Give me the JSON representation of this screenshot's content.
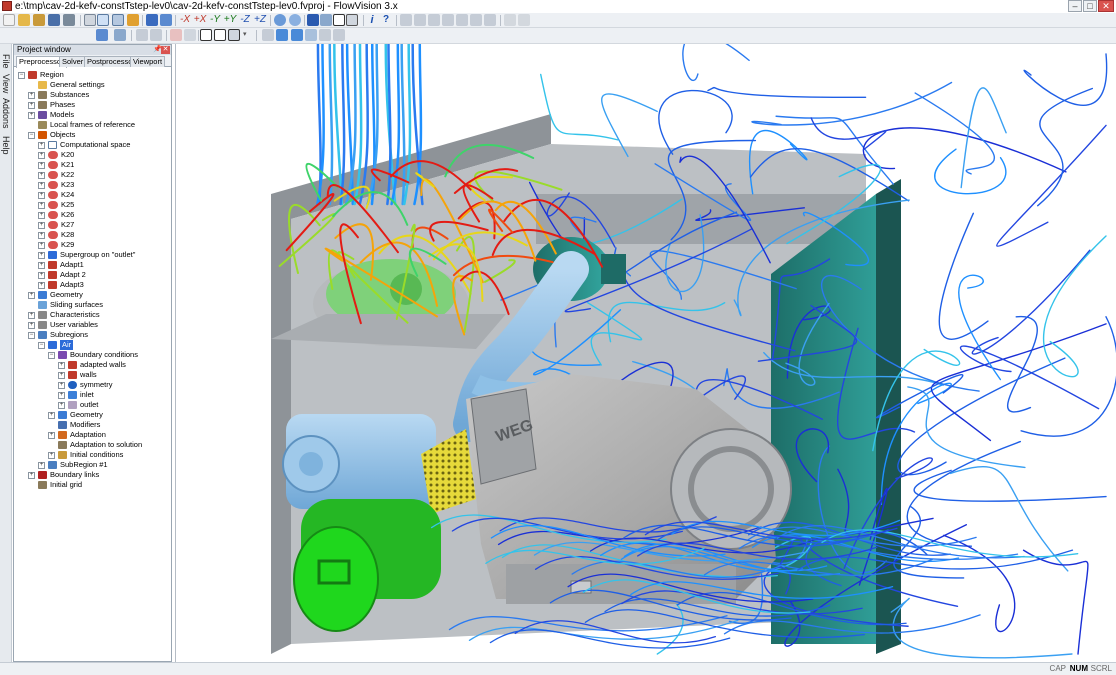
{
  "window": {
    "title": "e:\\tmp\\cav-2d-kefv-constTstep-lev0\\cav-2d-kefv-constTstep-lev0.fvproj - FlowVision 3.x",
    "minimize": "–",
    "maximize": "□",
    "close": "✕"
  },
  "toolbar": {
    "axis_buttons": [
      "-X",
      "+X",
      "-Y",
      "+Y",
      "-Z",
      "+Z"
    ]
  },
  "sidebar_tabs": [
    "File",
    "View",
    "Addons",
    "Help"
  ],
  "project_window": {
    "title": "Project window",
    "tabs": [
      "Preprocessor",
      "Solver",
      "Postprocessor",
      "Viewport"
    ],
    "active_tab": "Preprocessor",
    "tree": [
      {
        "label": "Region"
      },
      {
        "label": "General settings"
      },
      {
        "label": "Substances"
      },
      {
        "label": "Phases"
      },
      {
        "label": "Models"
      },
      {
        "label": "Local frames of reference"
      },
      {
        "label": "Objects"
      },
      {
        "label": "Computational space"
      },
      {
        "label": "K20"
      },
      {
        "label": "K21"
      },
      {
        "label": "K22"
      },
      {
        "label": "K23"
      },
      {
        "label": "K24"
      },
      {
        "label": "K25"
      },
      {
        "label": "K26"
      },
      {
        "label": "K27"
      },
      {
        "label": "K28"
      },
      {
        "label": "K29"
      },
      {
        "label": "Supergroup on \"outlet\""
      },
      {
        "label": "Adapt1"
      },
      {
        "label": "Adapt 2"
      },
      {
        "label": "Adapt3"
      },
      {
        "label": "Geometry"
      },
      {
        "label": "Sliding surfaces"
      },
      {
        "label": "Characteristics"
      },
      {
        "label": "User variables"
      },
      {
        "label": "Subregions"
      },
      {
        "label": "Air"
      },
      {
        "label": "Boundary conditions"
      },
      {
        "label": "adapted walls"
      },
      {
        "label": "walls"
      },
      {
        "label": "symmetry"
      },
      {
        "label": "inlet"
      },
      {
        "label": "outlet"
      },
      {
        "label": "Geometry"
      },
      {
        "label": "Modifiers"
      },
      {
        "label": "Adaptation"
      },
      {
        "label": "Adaptation to solution"
      },
      {
        "label": "Initial conditions"
      },
      {
        "label": "SubRegion #1"
      },
      {
        "label": "Boundary links"
      },
      {
        "label": "Initial grid"
      }
    ]
  },
  "viewport": {
    "motor_brand": "WEG"
  },
  "status": {
    "indicators": [
      "CAP",
      "NUM",
      "SCRL"
    ],
    "active": [
      "NUM"
    ]
  }
}
